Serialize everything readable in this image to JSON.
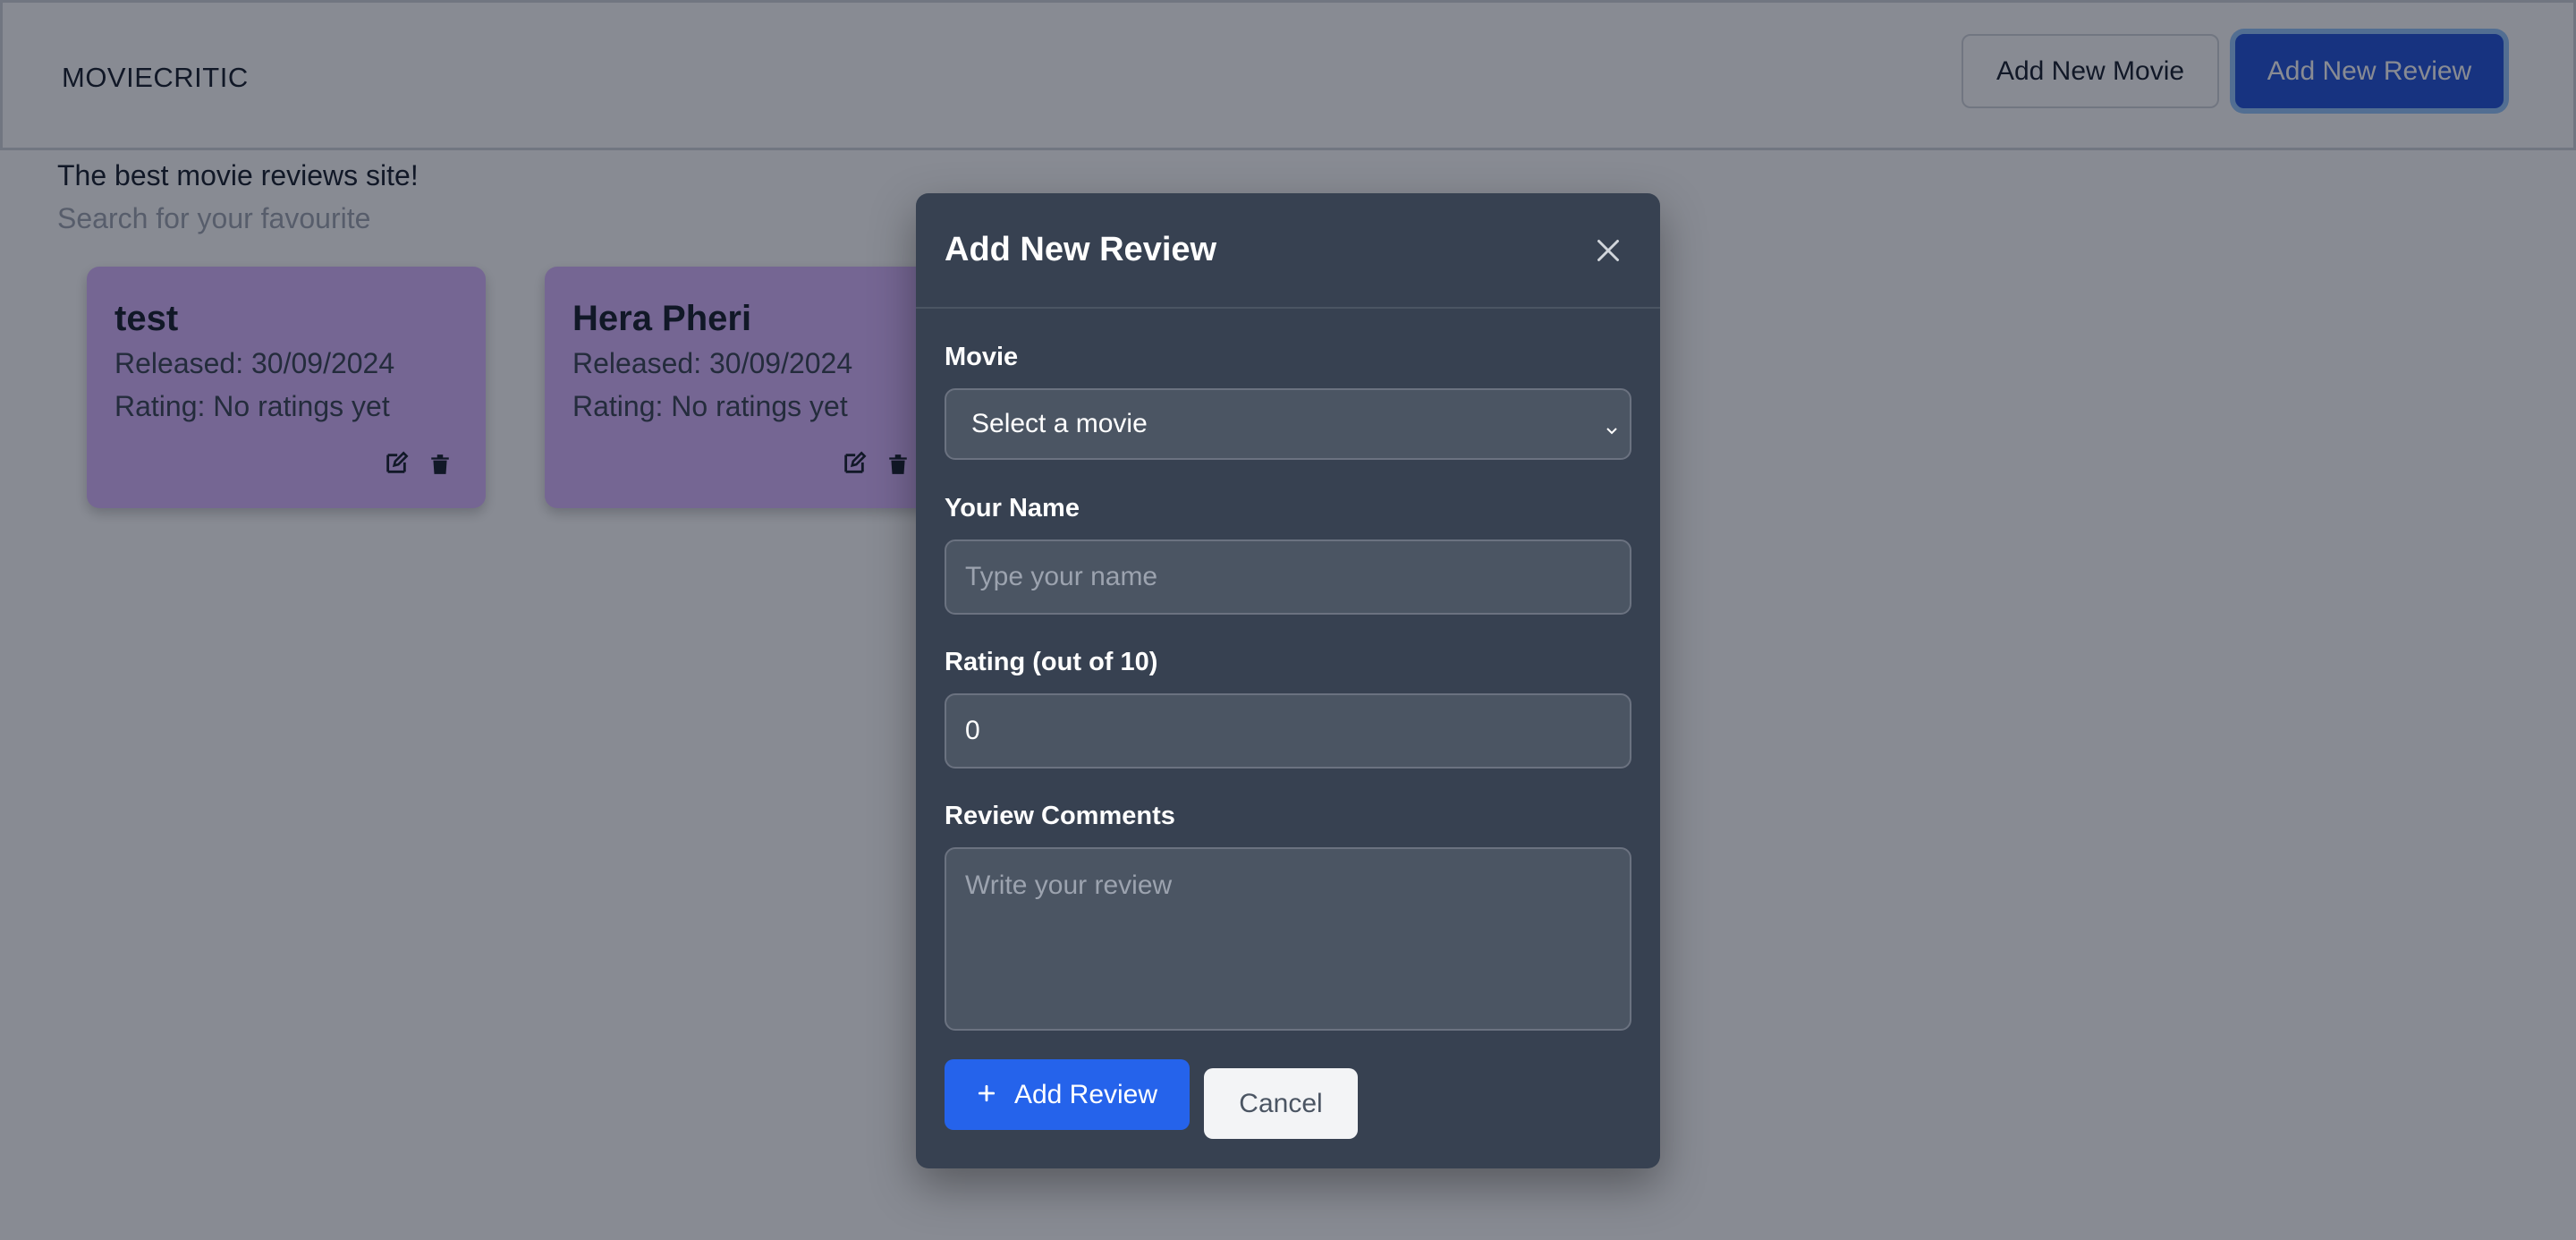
{
  "navbar": {
    "brand": "MOVIECRITIC",
    "add_movie_label": "Add New Movie",
    "add_review_label": "Add New Review"
  },
  "hero": {
    "tagline": "The best movie reviews site!",
    "search_placeholder": "Search for your favourite"
  },
  "movies": [
    {
      "title": "test",
      "released": "Released: 30/09/2024",
      "rating": "Rating: No ratings yet"
    },
    {
      "title": "Hera Pheri",
      "released": "Released: 30/09/2024",
      "rating": "Rating: No ratings yet"
    }
  ],
  "modal": {
    "title": "Add New Review",
    "movie_label": "Movie",
    "movie_select_value": "Select a movie",
    "name_label": "Your Name",
    "name_placeholder": "Type your name",
    "rating_label": "Rating (out of 10)",
    "rating_value": "0",
    "comments_label": "Review Comments",
    "comments_placeholder": "Write your review",
    "submit_label": "Add Review",
    "cancel_label": "Cancel"
  },
  "colors": {
    "primary": "#2563eb",
    "card": "#d8b4fe",
    "modal_bg": "#374151",
    "overlay": "rgba(17,24,39,0.5)"
  },
  "icons": [
    "edit-icon",
    "trash-icon",
    "close-icon",
    "chevron-down-icon",
    "plus-icon"
  ]
}
